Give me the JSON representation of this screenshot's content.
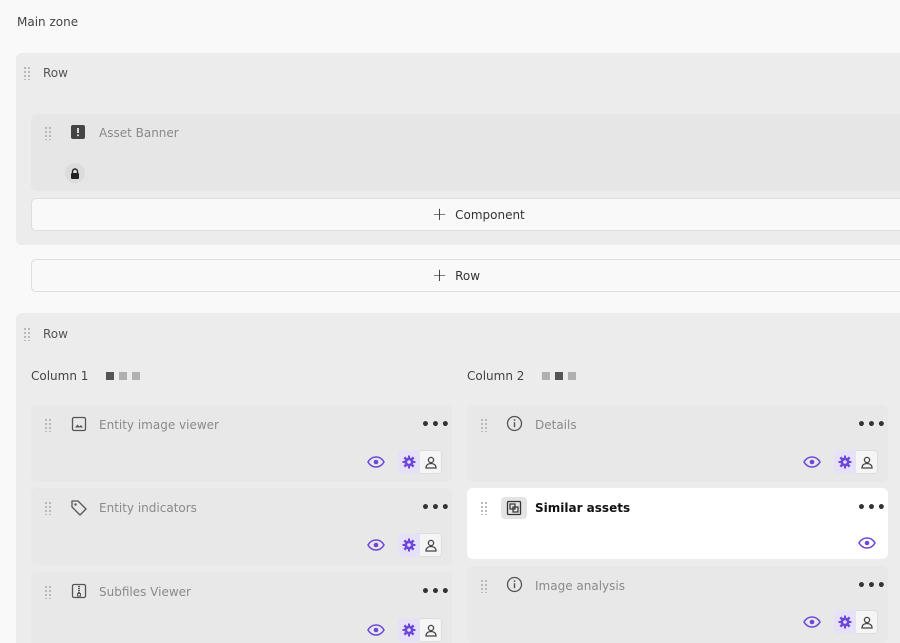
{
  "zone": {
    "title": "Main zone"
  },
  "rows": [
    {
      "label": "Row",
      "asset_banner": {
        "title": "Asset Banner"
      },
      "add_component_label": "Component"
    },
    {
      "label": "Row",
      "columns": [
        {
          "label": "Column 1",
          "layout_squares": [
            "#555555",
            "#b0b0b0",
            "#b0b0b0"
          ],
          "cards": [
            {
              "title": "Entity image viewer",
              "icon": "image-icon"
            },
            {
              "title": "Entity indicators",
              "icon": "tag-icon"
            },
            {
              "title": "Subfiles Viewer",
              "icon": "zip-icon"
            }
          ]
        },
        {
          "label": "Column 2",
          "layout_squares": [
            "#b0b0b0",
            "#555555",
            "#b0b0b0"
          ],
          "cards": [
            {
              "title": "Details",
              "icon": "info-icon"
            },
            {
              "title": "Similar assets",
              "icon": "similar-icon"
            },
            {
              "title": "Image analysis",
              "icon": "info-icon"
            }
          ]
        }
      ]
    }
  ],
  "add_row_label": "Row",
  "more_label": "•••",
  "colors": {
    "accent": "#6c47d9",
    "card_bg": "#e8e8e8",
    "row_bg": "#ececec"
  }
}
